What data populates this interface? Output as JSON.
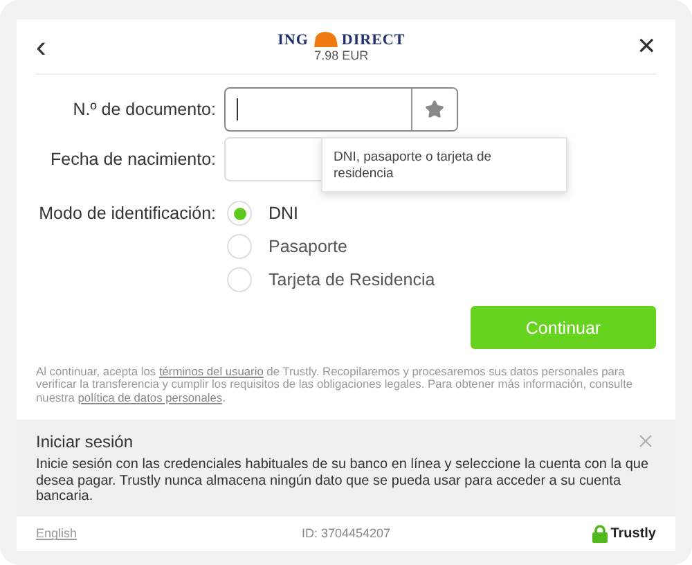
{
  "header": {
    "back": "‹",
    "logo": {
      "left": "ING",
      "right": "DIRECT"
    },
    "amount": "7.98 EUR",
    "close": "✕"
  },
  "form": {
    "fields": [
      {
        "label": "N.º de documento:",
        "kind": "document",
        "focused": true
      },
      {
        "label": "Fecha de nacimiento:",
        "kind": "date",
        "focused": false
      }
    ],
    "tooltip": "DNI, pasaporte o tarjeta de residencia",
    "mode_label": "Modo de identificación:",
    "modes": [
      {
        "label": "DNI",
        "selected": true
      },
      {
        "label": "Pasaporte",
        "selected": false
      },
      {
        "label": "Tarjeta de Residencia",
        "selected": false
      }
    ],
    "submit": "Continuar"
  },
  "legal": [
    {
      "kind": "text",
      "text": "Al continuar, acepta los "
    },
    {
      "kind": "link",
      "text": "términos del usuario"
    },
    {
      "kind": "text",
      "text": " de Trustly. Recopilaremos y procesaremos sus datos personales para verificar la transferencia y cumplir los requisitos de las obligaciones legales. Para obtener más información, consulte nuestra "
    },
    {
      "kind": "link",
      "text": "política de datos personales"
    },
    {
      "kind": "text",
      "text": "."
    }
  ],
  "info": {
    "title": "Iniciar sesión",
    "body": "Inicie sesión con las credenciales habituales de su banco en línea y seleccione la cuenta con la que desea pagar. Trustly nunca almacena ningún dato que se pueda usar para acceder a su cuenta bancaria."
  },
  "footer": {
    "language": "English",
    "id": "ID: 3704454207",
    "brand": "Trustly"
  }
}
